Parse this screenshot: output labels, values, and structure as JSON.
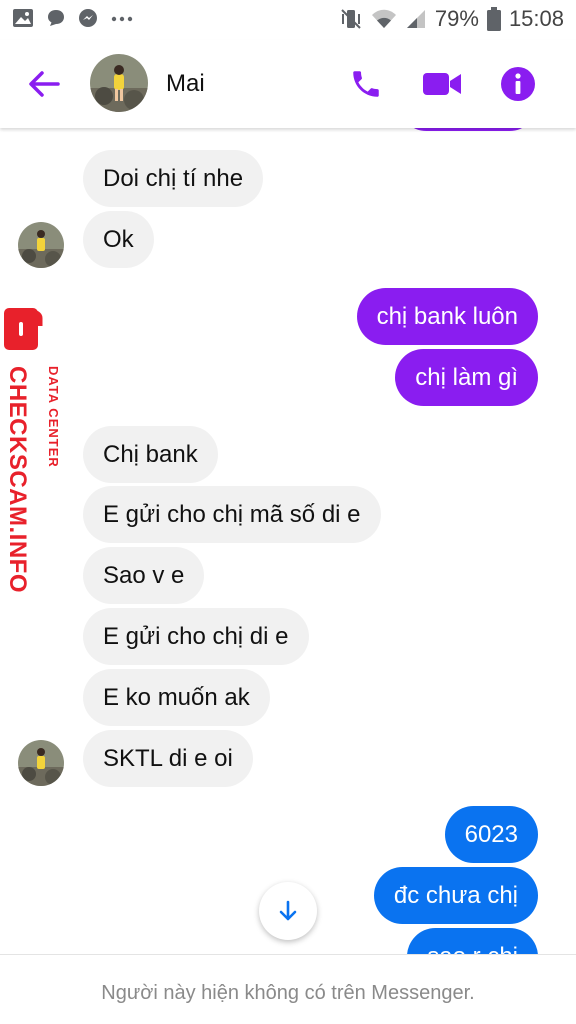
{
  "status_bar": {
    "battery": "79%",
    "time": "15:08"
  },
  "header": {
    "contact_name": "Mai"
  },
  "watermark": {
    "line1": "DATA CENTER",
    "line2": "CHECKSCAM.INFO"
  },
  "messages": [
    {
      "direction": "in",
      "text": "Doi chị tí nhe"
    },
    {
      "direction": "in",
      "text": "Ok"
    },
    {
      "direction": "out",
      "text": "chị bank luôn"
    },
    {
      "direction": "out",
      "text": "chị làm gì"
    },
    {
      "direction": "in",
      "text": "Chị bank"
    },
    {
      "direction": "in",
      "text": "E gửi cho chị mã số di e"
    },
    {
      "direction": "in",
      "text": "Sao v e"
    },
    {
      "direction": "in",
      "text": "E gửi cho chị di e"
    },
    {
      "direction": "in",
      "text": "E ko muốn ak"
    },
    {
      "direction": "in",
      "text": "SKTL di e oi"
    },
    {
      "direction": "out",
      "text": "6023"
    },
    {
      "direction": "out",
      "text": "đc chưa chị"
    },
    {
      "direction": "out",
      "text": "sao r chị"
    }
  ],
  "footer": {
    "notice": "Người này hiện không có trên Messenger."
  },
  "colors": {
    "accent_purple": "#8a1df0",
    "accent_blue": "#0a73f0",
    "incoming_bubble": "#f1f1f1",
    "watermark_red": "#e8212b"
  }
}
